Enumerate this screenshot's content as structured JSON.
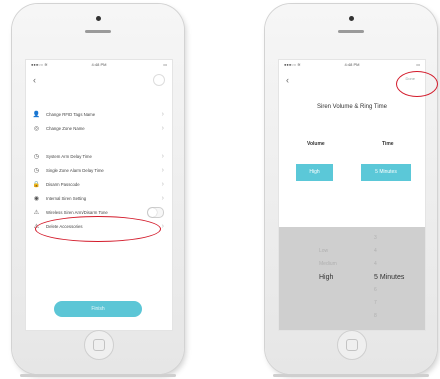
{
  "left_phone": {
    "status": {
      "left": "●●●○○ ≋",
      "center": "4:48 PM",
      "right": "▭"
    },
    "back_icon": "‹",
    "items": [
      {
        "icon": "person-icon",
        "glyph": "👤",
        "label": "Change RFID Tags Name",
        "type": "chevron"
      },
      {
        "icon": "zone-icon",
        "glyph": "◎",
        "label": "Change Zone Name",
        "type": "chevron"
      },
      {
        "icon": "gap",
        "glyph": "",
        "label": "",
        "type": "spacer"
      },
      {
        "icon": "clock-icon",
        "glyph": "◷",
        "label": "System Arm Delay Time",
        "type": "chevron"
      },
      {
        "icon": "alarm-icon",
        "glyph": "◷",
        "label": "Single Zone Alarm Delay Time",
        "type": "chevron"
      },
      {
        "icon": "lock-icon",
        "glyph": "🔒",
        "label": "Disarm Passcode",
        "type": "chevron"
      },
      {
        "icon": "siren-icon",
        "glyph": "◉",
        "label": "Internal Siren Setting",
        "type": "chevron"
      },
      {
        "icon": "beep-icon",
        "glyph": "⚠",
        "label": "Wireless Siren Arm/Disarm Tone",
        "type": "toggle"
      },
      {
        "icon": "delete-icon",
        "glyph": "⚠",
        "label": "Delete Accessories",
        "type": "chevron"
      }
    ],
    "chevron": "›",
    "finish_button": "Finish"
  },
  "right_phone": {
    "status": {
      "left": "●●●○○ ≋",
      "center": "4:48 PM",
      "right": "▭"
    },
    "back_icon": "‹",
    "done_label": "Done",
    "title": "Siren Volume & Ring Time",
    "volume_label": "Volume",
    "time_label": "Time",
    "volume_value": "High",
    "time_value": "5 Minutes",
    "picker": {
      "rows": [
        {
          "a": "",
          "b": "3"
        },
        {
          "a": "Low",
          "b": "4"
        },
        {
          "a": "Medium",
          "b": "4"
        },
        {
          "a": "High",
          "b": "5 Minutes",
          "selected": true
        },
        {
          "a": "",
          "b": "6"
        },
        {
          "a": "",
          "b": "7"
        },
        {
          "a": "",
          "b": "8"
        }
      ]
    }
  },
  "colors": {
    "accent": "#5bc8d8",
    "highlight": "#d31a2a"
  }
}
